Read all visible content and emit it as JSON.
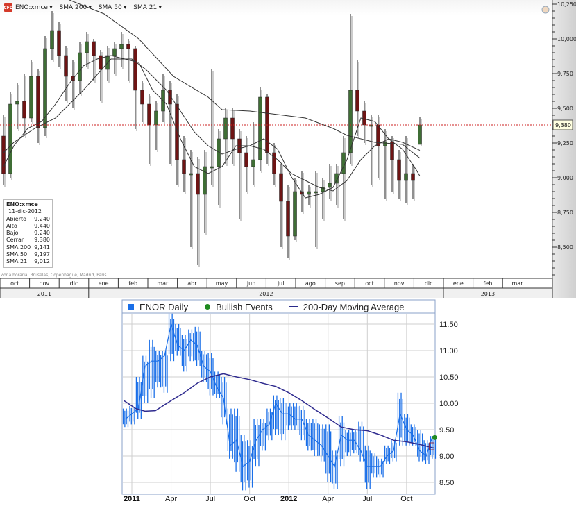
{
  "header": {
    "symbol": "ENO:xmce",
    "indicators": [
      "SMA 200",
      "SMA 50",
      "SMA 21"
    ],
    "logo_text": "CFD"
  },
  "infobox": {
    "title": "ENO:xmce",
    "date": "11-dic-2012",
    "rows": [
      {
        "label": "Abierto",
        "value": "9,240"
      },
      {
        "label": "Alto",
        "value": "9,440"
      },
      {
        "label": "Bajo",
        "value": "9,240"
      },
      {
        "label": "Cerrar",
        "value": "9,380"
      },
      {
        "label": "SMA 200",
        "value": "9,141"
      },
      {
        "label": "SMA 50",
        "value": "9,197"
      },
      {
        "label": "SMA 21",
        "value": "9,012"
      }
    ]
  },
  "timezone": "Zona horaria: Bruselas, Copenhague, Madrid, París",
  "colors": {
    "up": "#3f6e35",
    "down": "#6e1414",
    "sma": "#333333",
    "price_line": "#cc2222",
    "enor": "#1a6fe8",
    "ma200": "#2e2a8e",
    "bullish": "#1f8a1f"
  },
  "chart_data": [
    {
      "type": "candlestick",
      "title": "ENO:xmce",
      "interval": "weekly (approx.)",
      "ylim": [
        8.3,
        10.28
      ],
      "yticks": [
        8.5,
        8.75,
        9.0,
        9.25,
        9.5,
        9.75,
        10.0,
        10.25
      ],
      "ytick_labels": [
        "8,500",
        "8,750",
        "9,000",
        "9,250",
        "9,500",
        "9,750",
        "10,000",
        "10,250"
      ],
      "last_price": 9.38,
      "last_price_label": "9,380",
      "months": [
        "oct",
        "nov",
        "dic",
        "ene",
        "feb",
        "mar",
        "abr",
        "may",
        "jun",
        "jul",
        "ago",
        "sep",
        "oct",
        "nov",
        "dic",
        "ene",
        "feb",
        "mar"
      ],
      "years": [
        {
          "label": "2011",
          "months": 3
        },
        {
          "label": "2012",
          "months": 12
        },
        {
          "label": "2013",
          "months": 3
        }
      ],
      "weeks_per_month": 4.26,
      "candles_ohlc": [
        [
          9.3,
          9.45,
          8.95,
          9.03
        ],
        [
          9.03,
          9.62,
          9.0,
          9.53
        ],
        [
          9.53,
          9.68,
          9.35,
          9.55
        ],
        [
          9.55,
          9.75,
          9.3,
          9.43
        ],
        [
          9.43,
          9.85,
          9.4,
          9.73
        ],
        [
          9.73,
          9.78,
          9.25,
          9.36
        ],
        [
          9.36,
          10.02,
          9.3,
          9.93
        ],
        [
          9.93,
          10.2,
          9.85,
          10.06
        ],
        [
          10.06,
          10.12,
          9.8,
          9.88
        ],
        [
          9.88,
          9.95,
          9.55,
          9.73
        ],
        [
          9.73,
          9.85,
          9.5,
          9.7
        ],
        [
          9.7,
          9.98,
          9.6,
          9.9
        ],
        [
          9.9,
          10.05,
          9.8,
          9.98
        ],
        [
          9.98,
          10.0,
          9.7,
          9.88
        ],
        [
          9.88,
          9.92,
          9.55,
          9.78
        ],
        [
          9.78,
          9.95,
          9.7,
          9.88
        ],
        [
          9.88,
          9.98,
          9.75,
          9.93
        ],
        [
          9.93,
          10.05,
          9.8,
          9.96
        ],
        [
          9.96,
          10.0,
          9.7,
          9.93
        ],
        [
          9.93,
          9.95,
          9.35,
          9.63
        ],
        [
          9.63,
          9.7,
          9.4,
          9.53
        ],
        [
          9.53,
          9.6,
          9.1,
          9.38
        ],
        [
          9.38,
          9.55,
          9.2,
          9.48
        ],
        [
          9.48,
          9.75,
          9.4,
          9.63
        ],
        [
          9.63,
          9.7,
          9.1,
          9.53
        ],
        [
          9.53,
          9.6,
          8.95,
          9.13
        ],
        [
          9.13,
          9.3,
          8.9,
          9.03
        ],
        [
          9.03,
          9.2,
          8.5,
          9.03
        ],
        [
          9.03,
          9.15,
          8.37,
          8.88
        ],
        [
          8.88,
          9.2,
          8.6,
          9.08
        ],
        [
          9.08,
          9.78,
          8.95,
          9.08
        ],
        [
          9.08,
          9.35,
          8.8,
          9.28
        ],
        [
          9.28,
          9.5,
          9.1,
          9.43
        ],
        [
          9.43,
          9.5,
          9.1,
          9.28
        ],
        [
          9.28,
          9.35,
          8.7,
          9.18
        ],
        [
          9.18,
          9.3,
          8.9,
          9.08
        ],
        [
          9.08,
          9.4,
          8.95,
          9.13
        ],
        [
          9.13,
          9.65,
          9.05,
          9.58
        ],
        [
          9.58,
          9.6,
          9.1,
          9.18
        ],
        [
          9.18,
          9.25,
          8.95,
          9.03
        ],
        [
          9.03,
          9.1,
          8.5,
          8.83
        ],
        [
          8.83,
          8.95,
          8.42,
          8.58
        ],
        [
          8.58,
          9.0,
          8.55,
          8.9
        ],
        [
          8.9,
          9.05,
          8.75,
          8.88
        ],
        [
          8.88,
          8.95,
          8.8,
          8.9
        ],
        [
          8.9,
          9.05,
          8.5,
          8.9
        ],
        [
          8.9,
          9.0,
          8.7,
          8.93
        ],
        [
          8.93,
          9.1,
          8.85,
          8.96
        ],
        [
          8.96,
          9.1,
          8.8,
          9.03
        ],
        [
          9.03,
          9.3,
          8.7,
          9.18
        ],
        [
          9.18,
          10.18,
          9.1,
          9.63
        ],
        [
          9.63,
          9.85,
          9.3,
          9.48
        ],
        [
          9.48,
          9.55,
          9.25,
          9.38
        ],
        [
          9.38,
          9.45,
          8.95,
          9.38
        ],
        [
          9.38,
          9.45,
          9.0,
          9.23
        ],
        [
          9.23,
          9.35,
          8.85,
          9.26
        ],
        [
          9.26,
          9.3,
          8.9,
          9.13
        ],
        [
          9.13,
          9.2,
          8.85,
          8.98
        ],
        [
          8.98,
          9.3,
          8.82,
          9.03
        ],
        [
          9.03,
          9.1,
          8.85,
          8.98
        ],
        [
          9.24,
          9.44,
          9.24,
          9.38
        ]
      ],
      "sma200": [
        [
          9.5,
          10.28
        ],
        [
          14.5,
          10.18
        ],
        [
          19.5,
          10.0
        ],
        [
          24.5,
          9.73
        ],
        [
          29.5,
          9.58
        ],
        [
          31.5,
          9.49
        ],
        [
          35.5,
          9.48
        ],
        [
          39.5,
          9.455
        ],
        [
          43.5,
          9.43
        ],
        [
          47.5,
          9.355
        ],
        [
          49.5,
          9.305
        ],
        [
          53.5,
          9.255
        ],
        [
          57.5,
          9.24
        ],
        [
          60,
          9.141
        ]
      ],
      "sma50": [
        [
          0,
          9.18
        ],
        [
          1.5,
          9.255
        ],
        [
          4.5,
          9.355
        ],
        [
          7.5,
          9.43
        ],
        [
          11.5,
          9.63
        ],
        [
          15.5,
          9.855
        ],
        [
          18.5,
          9.855
        ],
        [
          20.5,
          9.78
        ],
        [
          23.5,
          9.63
        ],
        [
          25.5,
          9.48
        ],
        [
          27.5,
          9.33
        ],
        [
          29.5,
          9.23
        ],
        [
          31.5,
          9.17
        ],
        [
          33.5,
          9.205
        ],
        [
          35.5,
          9.23
        ],
        [
          37.5,
          9.205
        ],
        [
          39.5,
          9.13
        ],
        [
          41.5,
          9.03
        ],
        [
          43.5,
          8.98
        ],
        [
          45.5,
          8.93
        ],
        [
          47.5,
          8.905
        ],
        [
          49.5,
          8.98
        ],
        [
          51.5,
          9.13
        ],
        [
          53.5,
          9.23
        ],
        [
          55.5,
          9.28
        ],
        [
          57.5,
          9.255
        ],
        [
          60,
          9.197
        ]
      ],
      "sma21": [
        [
          0,
          9.08
        ],
        [
          1.5,
          9.23
        ],
        [
          3.5,
          9.355
        ],
        [
          5.5,
          9.405
        ],
        [
          7.5,
          9.53
        ],
        [
          9.5,
          9.68
        ],
        [
          11.5,
          9.805
        ],
        [
          13.5,
          9.855
        ],
        [
          15.5,
          9.88
        ],
        [
          17.5,
          9.855
        ],
        [
          19.5,
          9.83
        ],
        [
          21.5,
          9.63
        ],
        [
          23.5,
          9.53
        ],
        [
          25.5,
          9.28
        ],
        [
          27.5,
          9.08
        ],
        [
          29.5,
          9.03
        ],
        [
          31.5,
          9.08
        ],
        [
          33.5,
          9.23
        ],
        [
          35.5,
          9.23
        ],
        [
          37.5,
          9.28
        ],
        [
          39.5,
          9.205
        ],
        [
          41.5,
          9.005
        ],
        [
          43.5,
          8.855
        ],
        [
          45.5,
          8.88
        ],
        [
          47.5,
          8.93
        ],
        [
          49.5,
          9.13
        ],
        [
          51.5,
          9.43
        ],
        [
          53.5,
          9.405
        ],
        [
          55.5,
          9.28
        ],
        [
          57.5,
          9.205
        ],
        [
          59.5,
          9.055
        ],
        [
          60,
          9.012
        ]
      ]
    },
    {
      "type": "line",
      "legend": [
        "ENOR Daily",
        "Bullish Events",
        "200-Day Moving Average"
      ],
      "legend_placement": "top",
      "ylim": [
        8.3,
        11.75
      ],
      "yticks": [
        8.5,
        9.0,
        9.5,
        10.0,
        10.5,
        11.0,
        11.5
      ],
      "ytick_labels": [
        "8.50",
        "9.00",
        "9.50",
        "10.00",
        "10.50",
        "11.00",
        "11.50"
      ],
      "xlim_months_from_jan2011": [
        -0.65,
        23.2
      ],
      "xticks": [
        {
          "t": 0,
          "label": "2011",
          "bold": true
        },
        {
          "t": 3,
          "label": "Apr"
        },
        {
          "t": 6,
          "label": "Jul"
        },
        {
          "t": 9,
          "label": "Oct"
        },
        {
          "t": 12,
          "label": "2012",
          "bold": true
        },
        {
          "t": 15,
          "label": "Apr"
        },
        {
          "t": 18,
          "label": "Jul"
        },
        {
          "t": 21,
          "label": "Oct"
        }
      ],
      "enor_daily_half_month_t_low_high_close": [
        [
          -0.5,
          9.55,
          9.9,
          9.7
        ],
        [
          0,
          9.6,
          9.95,
          9.8
        ],
        [
          0.5,
          9.7,
          10.5,
          9.9
        ],
        [
          1,
          10.0,
          10.9,
          10.7
        ],
        [
          1.5,
          10.1,
          11.2,
          10.8
        ],
        [
          2,
          10.3,
          11.0,
          10.8
        ],
        [
          2.5,
          10.2,
          11.0,
          10.9
        ],
        [
          3,
          10.8,
          11.7,
          11.5
        ],
        [
          3.5,
          10.9,
          11.5,
          11.1
        ],
        [
          4,
          10.6,
          11.3,
          11.0
        ],
        [
          4.5,
          10.8,
          11.4,
          11.2
        ],
        [
          5,
          10.7,
          11.45,
          11.1
        ],
        [
          5.5,
          10.4,
          11.0,
          10.7
        ],
        [
          6,
          10.15,
          10.95,
          10.6
        ],
        [
          6.5,
          10.1,
          10.6,
          10.3
        ],
        [
          7,
          9.6,
          10.5,
          10.1
        ],
        [
          7.5,
          8.95,
          9.9,
          9.2
        ],
        [
          8,
          8.7,
          9.9,
          9.3
        ],
        [
          8.5,
          8.35,
          9.4,
          8.8
        ],
        [
          9,
          8.4,
          9.3,
          8.9
        ],
        [
          9.5,
          8.8,
          9.7,
          9.3
        ],
        [
          10,
          9.1,
          9.7,
          9.5
        ],
        [
          10.5,
          9.3,
          9.9,
          9.6
        ],
        [
          11,
          9.4,
          10.15,
          10.0
        ],
        [
          11.5,
          9.3,
          10.1,
          9.8
        ],
        [
          12,
          9.5,
          10.0,
          9.8
        ],
        [
          12.5,
          9.5,
          10.0,
          9.7
        ],
        [
          13,
          9.3,
          9.95,
          9.7
        ],
        [
          13.5,
          9.1,
          9.7,
          9.4
        ],
        [
          14,
          9.0,
          9.7,
          9.3
        ],
        [
          14.5,
          8.9,
          9.6,
          9.2
        ],
        [
          15,
          8.5,
          9.6,
          9.0
        ],
        [
          15.5,
          8.37,
          9.1,
          8.8
        ],
        [
          16,
          8.8,
          9.75,
          9.4
        ],
        [
          16.5,
          9.0,
          9.5,
          9.3
        ],
        [
          17,
          9.05,
          9.5,
          9.3
        ],
        [
          17.5,
          8.9,
          9.65,
          9.1
        ],
        [
          18,
          8.37,
          9.2,
          8.8
        ],
        [
          18.5,
          8.6,
          9.05,
          8.8
        ],
        [
          19,
          8.6,
          8.95,
          8.8
        ],
        [
          19.5,
          8.85,
          9.2,
          9.0
        ],
        [
          20,
          8.9,
          9.3,
          9.1
        ],
        [
          20.5,
          9.2,
          10.2,
          9.8
        ],
        [
          21,
          9.2,
          9.8,
          9.5
        ],
        [
          21.5,
          9.2,
          9.6,
          9.4
        ],
        [
          22,
          8.9,
          9.5,
          9.1
        ],
        [
          22.5,
          8.85,
          9.3,
          9.0
        ],
        [
          23,
          8.95,
          9.38,
          9.38
        ]
      ],
      "ma200": [
        [
          -0.6,
          10.05
        ],
        [
          0.3,
          9.9
        ],
        [
          1,
          9.85
        ],
        [
          1.8,
          9.86
        ],
        [
          3,
          10.05
        ],
        [
          4,
          10.2
        ],
        [
          5,
          10.38
        ],
        [
          6,
          10.5
        ],
        [
          7,
          10.56
        ],
        [
          8,
          10.5
        ],
        [
          9,
          10.45
        ],
        [
          10,
          10.38
        ],
        [
          11,
          10.32
        ],
        [
          12,
          10.2
        ],
        [
          13,
          10.05
        ],
        [
          14,
          9.88
        ],
        [
          15,
          9.72
        ],
        [
          16,
          9.55
        ],
        [
          17,
          9.5
        ],
        [
          18,
          9.48
        ],
        [
          19,
          9.4
        ],
        [
          20,
          9.3
        ],
        [
          21,
          9.27
        ],
        [
          22,
          9.22
        ],
        [
          23.1,
          9.15
        ]
      ],
      "bullish_events": [
        [
          23.15,
          9.35
        ]
      ]
    }
  ]
}
